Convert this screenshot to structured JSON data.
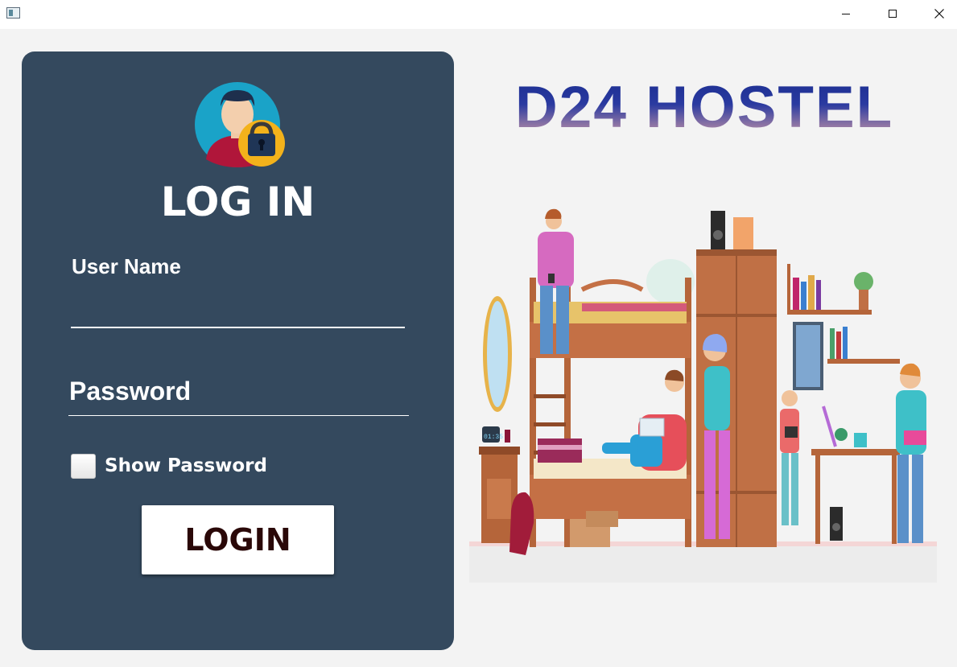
{
  "window": {
    "minimize_icon": "minimize-icon",
    "maximize_icon": "maximize-icon",
    "close_icon": "close-icon"
  },
  "login_panel": {
    "avatar_icon": "user-lock-avatar-icon",
    "heading": "LOG IN",
    "username_label": "User Name",
    "username_value": "",
    "password_label": "Password",
    "password_value": "",
    "show_password_label": "Show Password",
    "show_password_checked": false,
    "login_button": "LOGIN"
  },
  "brand": {
    "title": "D24 HOSTEL",
    "illustration": "hostel-dorm-room-illustration",
    "clock_text": "01:35"
  },
  "colors": {
    "panel_bg": "#34495e",
    "page_bg": "#f3f3f3",
    "title_gradient_top": "#1a2d8f",
    "title_gradient_bottom": "#d7a0a8"
  }
}
